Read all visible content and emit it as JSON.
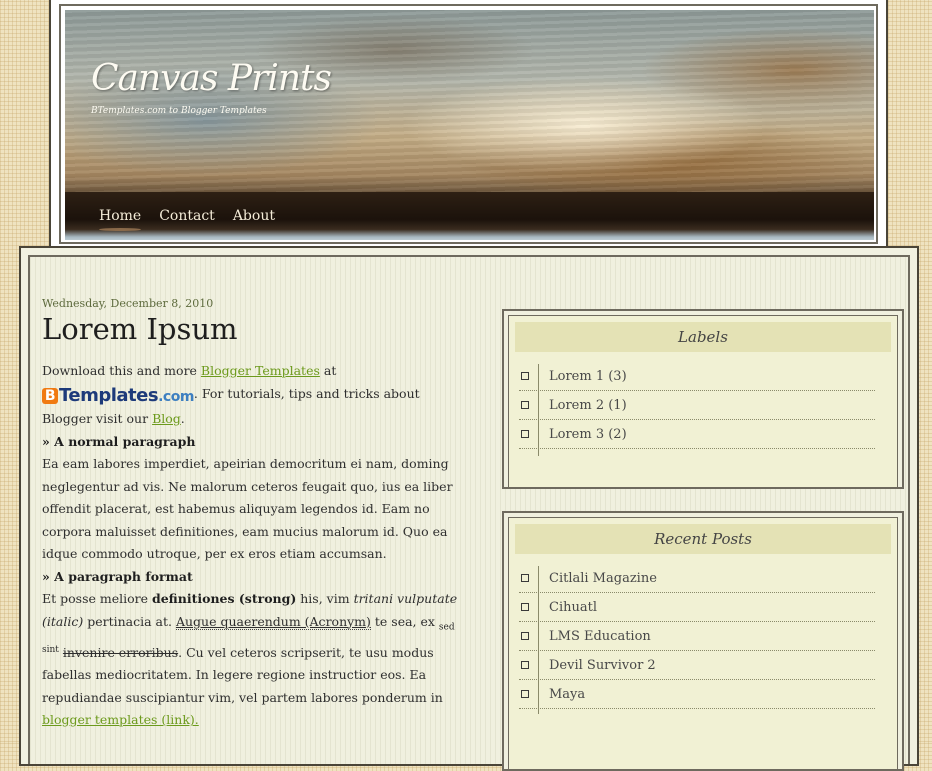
{
  "header": {
    "title": "Canvas Prints",
    "description": "BTemplates.com to Blogger Templates",
    "nav": [
      "Home",
      "Contact",
      "About"
    ]
  },
  "post": {
    "date": "Wednesday, December 8, 2010",
    "title": "Lorem Ipsum",
    "intro_1": "Download this and more ",
    "intro_link_1": "Blogger Templates",
    "intro_2": " at",
    "logo_b": "B",
    "logo_text": "Templates",
    "logo_com": ".com",
    "intro_3": ". For tutorials, tips and tricks about Blogger visit our ",
    "intro_link_2": "Blog",
    "intro_4": ".",
    "heading_1": "» A normal paragraph",
    "normal_paragraph": "Ea eam labores imperdiet, apeirian democritum ei nam, doming neglegentur ad vis. Ne malorum ceteros feugait quo, ius ea liber offendit placerat, est habemus aliquyam legendos id. Eam no corpora maluisset definitiones, eam mucius malorum id. Quo ea idque commodo utroque, per ex eros etiam accumsan.",
    "heading_2": "» A paragraph format",
    "format_1": "Et posse meliore ",
    "format_strong": "definitiones (strong)",
    "format_2": " his, vim ",
    "format_italic": "tritani vulputate (italic)",
    "format_3": " pertinacia at. ",
    "format_acronym": "Augue quaerendum (Acronym)",
    "format_4": " te sea, ex ",
    "format_sub": "sed",
    "format_sup": "sint",
    "format_strike": "invenire erroribus",
    "format_5": ". Cu vel ceteros scripserit, te usu modus fabellas mediocritatem. In legere regione instructior eos. Ea repudiandae suscipiantur vim, vel partem labores ponderum in ",
    "format_link": "blogger templates (link).",
    "format_6": ""
  },
  "sidebar": {
    "labels": {
      "title": "Labels",
      "items": [
        "Lorem 1 (3)",
        "Lorem 2 (1)",
        "Lorem 3 (2)"
      ]
    },
    "recent_posts": {
      "title": "Recent Posts",
      "items": [
        "Citlali Magazine",
        "Cihuatl",
        "LMS Education",
        "Devil Survivor 2",
        "Maya"
      ]
    }
  },
  "colors": {
    "link": "#6c9a1c",
    "widget_title_bg": "#e4e2b5",
    "page_bg": "#efe3c0",
    "content_bg": "#f0f0df"
  }
}
